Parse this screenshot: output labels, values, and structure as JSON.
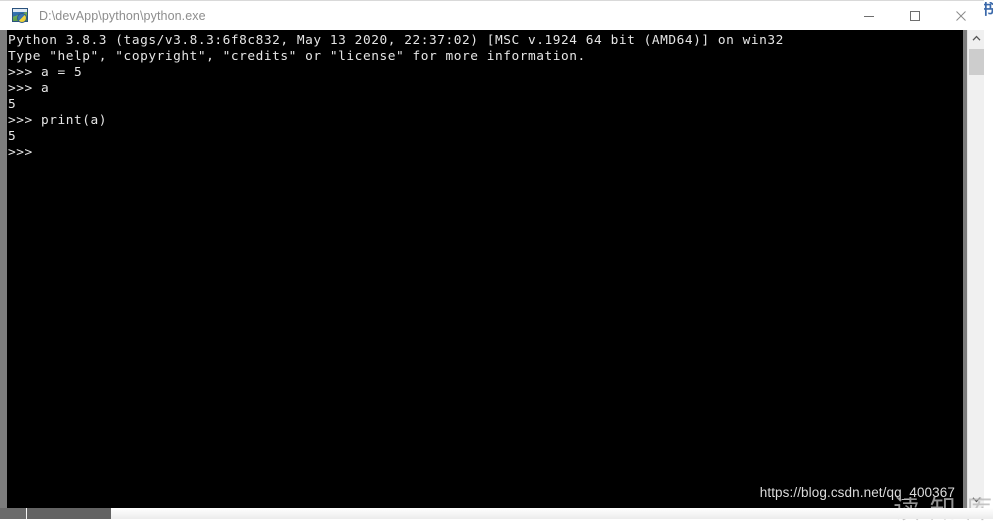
{
  "window": {
    "title": "D:\\devApp\\python\\python.exe",
    "icon": "python-console-icon",
    "controls": {
      "minimize": "Minimize",
      "maximize": "Maximize",
      "close": "Close"
    }
  },
  "console": {
    "lines": [
      "Python 3.8.3 (tags/v3.8.3:6f8c832, May 13 2020, 22:37:02) [MSC v.1924 64 bit (AMD64)] on win32",
      "Type \"help\", \"copyright\", \"credits\" or \"license\" for more information.",
      ">>> a = 5",
      ">>> a",
      "5",
      ">>> print(a)",
      "5",
      ">>> "
    ],
    "text": "Python 3.8.3 (tags/v3.8.3:6f8c832, May 13 2020, 22:37:02) [MSC v.1924 64 bit (AMD64)] on win32\nType \"help\", \"copyright\", \"credits\" or \"license\" for more information.\n>>> a = 5\n>>> a\n5\n>>> print(a)\n5\n>>> ",
    "background_color": "#000000",
    "text_color": "#e6e6e6",
    "watermark": "https://blog.csdn.net/qq_400367"
  },
  "watermarks": {
    "corner_top_right": "书",
    "bottom_right": "读 知 库"
  },
  "scrollbars": {
    "vertical": {
      "up_arrow": "scroll-up-icon",
      "down_arrow": "scroll-down-icon",
      "thumb_position_pct": 4
    },
    "horizontal": {
      "left_arrow": "scroll-left-icon",
      "thumb_position_pct": 3
    }
  }
}
